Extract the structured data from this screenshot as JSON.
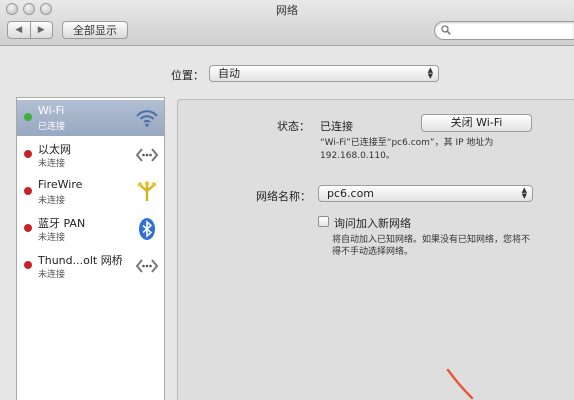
{
  "window": {
    "title": "网络",
    "back_glyph": "◀",
    "forward_glyph": "▶",
    "show_all_label": "全部显示",
    "search_icon": "search-icon"
  },
  "location": {
    "label": "位置：",
    "value": "自动"
  },
  "services": [
    {
      "name": "Wi-Fi",
      "status": "已连接",
      "dot_color": "#3fae3f",
      "icon": "wifi-icon",
      "selected": true
    },
    {
      "name": "以太网",
      "status": "未连接",
      "dot_color": "#c8232b",
      "icon": "ethernet-icon",
      "selected": false
    },
    {
      "name": "FireWire",
      "status": "未连接",
      "dot_color": "#c8232b",
      "icon": "firewire-icon",
      "selected": false
    },
    {
      "name": "蓝牙 PAN",
      "status": "未连接",
      "dot_color": "#c8232b",
      "icon": "bluetooth-icon",
      "selected": false
    },
    {
      "name": "Thund...olt 网桥",
      "status": "未连接",
      "dot_color": "#c8232b",
      "icon": "thunderbolt-bridge-icon",
      "selected": false
    }
  ],
  "detail": {
    "status_label": "状态：",
    "status_value": "已连接",
    "toggle_wifi_label": "关闭 Wi-Fi",
    "status_desc_line1": "“Wi-Fi”已连接至“pc6.com”，其 IP 地址为",
    "status_desc_line2": "192.168.0.110。",
    "network_name_label": "网络名称：",
    "network_name_value": "pc6.com",
    "ask_join_label": "询问加入新网络",
    "ask_join_desc_line1": "将自动加入已知网络。如果没有已知网络，您将不",
    "ask_join_desc_line2": "得不手动选择网络。"
  },
  "colors": {
    "selected_row": "#a3b2c9",
    "connected": "#3fae3f",
    "disconnected": "#c8232b",
    "annotation": "#e8553a"
  }
}
